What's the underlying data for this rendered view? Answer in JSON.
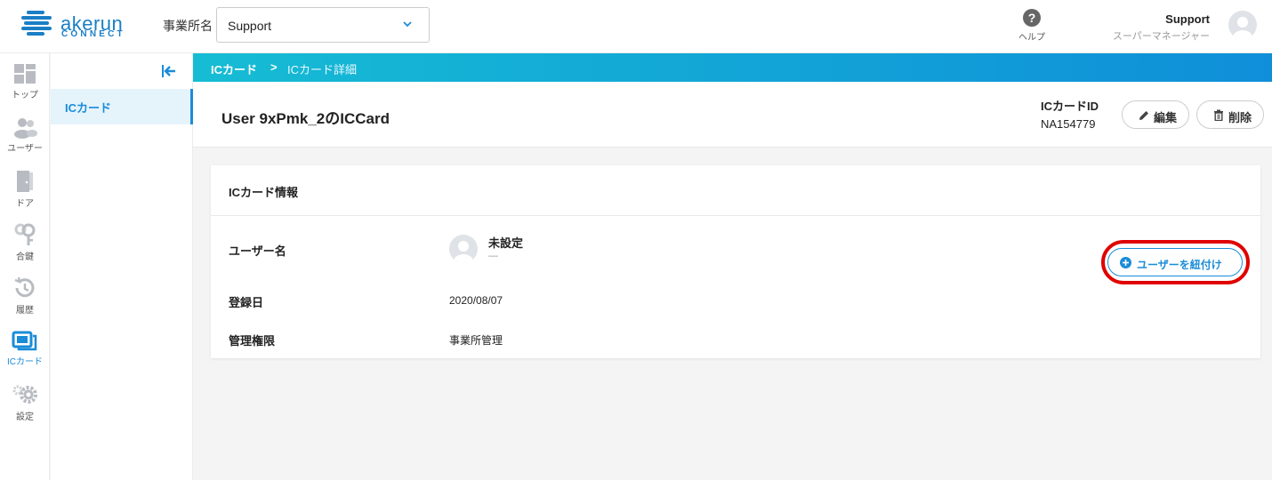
{
  "header": {
    "logo_main": "akerun",
    "logo_sub": "CONNECT",
    "office_label": "事業所名",
    "office_value": "Support",
    "help_label": "ヘルプ",
    "user_name": "Support",
    "user_role": "スーパーマネージャー"
  },
  "nav": {
    "items": [
      {
        "label": "トップ",
        "icon": "dashboard-icon"
      },
      {
        "label": "ユーザー",
        "icon": "users-icon"
      },
      {
        "label": "ドア",
        "icon": "door-icon"
      },
      {
        "label": "合鍵",
        "icon": "key-icon"
      },
      {
        "label": "履歴",
        "icon": "history-icon"
      },
      {
        "label": "ICカード",
        "icon": "ic-card-icon",
        "active": true
      },
      {
        "label": "設定",
        "icon": "settings-icon"
      }
    ]
  },
  "sub_menu": {
    "item": "ICカード"
  },
  "breadcrumb": {
    "parent": "ICカード",
    "separator": ">",
    "current": "ICカード詳細"
  },
  "title_band": {
    "title": "User 9xPmk_2のICCard",
    "card_id_label": "ICカードID",
    "card_id_value": "NA154779",
    "edit_label": "編集",
    "delete_label": "削除"
  },
  "info": {
    "heading": "ICカード情報",
    "user_label": "ユーザー名",
    "user_value": "未設定",
    "user_sub": "—",
    "link_button": "ユーザーを紐付け",
    "registered_label": "登録日",
    "registered_value": "2020/08/07",
    "permission_label": "管理権限",
    "permission_value": "事業所管理"
  },
  "colors": {
    "accent": "#1a8cd8",
    "gradient_start": "#16bcd4",
    "gradient_end": "#0f8fd9",
    "highlight": "#e00000"
  }
}
